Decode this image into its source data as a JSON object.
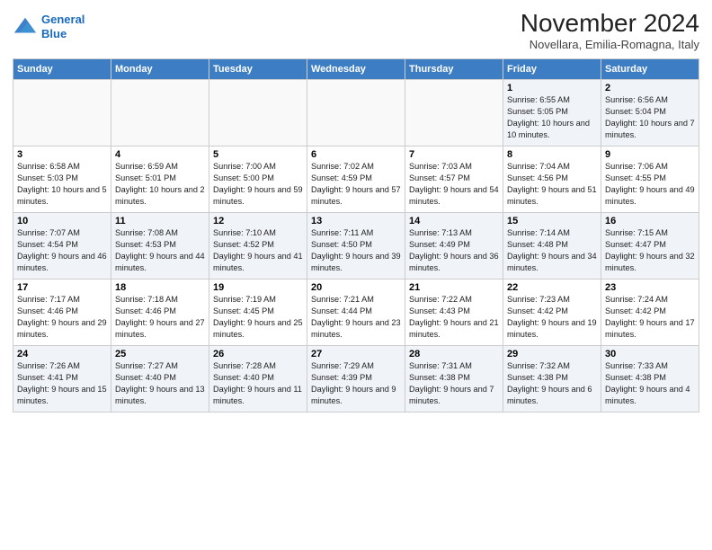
{
  "header": {
    "title": "November 2024",
    "location": "Novellara, Emilia-Romagna, Italy",
    "logo_line1": "General",
    "logo_line2": "Blue"
  },
  "days_of_week": [
    "Sunday",
    "Monday",
    "Tuesday",
    "Wednesday",
    "Thursday",
    "Friday",
    "Saturday"
  ],
  "weeks": [
    [
      {
        "day": "",
        "info": ""
      },
      {
        "day": "",
        "info": ""
      },
      {
        "day": "",
        "info": ""
      },
      {
        "day": "",
        "info": ""
      },
      {
        "day": "",
        "info": ""
      },
      {
        "day": "1",
        "info": "Sunrise: 6:55 AM\nSunset: 5:05 PM\nDaylight: 10 hours and 10 minutes."
      },
      {
        "day": "2",
        "info": "Sunrise: 6:56 AM\nSunset: 5:04 PM\nDaylight: 10 hours and 7 minutes."
      }
    ],
    [
      {
        "day": "3",
        "info": "Sunrise: 6:58 AM\nSunset: 5:03 PM\nDaylight: 10 hours and 5 minutes."
      },
      {
        "day": "4",
        "info": "Sunrise: 6:59 AM\nSunset: 5:01 PM\nDaylight: 10 hours and 2 minutes."
      },
      {
        "day": "5",
        "info": "Sunrise: 7:00 AM\nSunset: 5:00 PM\nDaylight: 9 hours and 59 minutes."
      },
      {
        "day": "6",
        "info": "Sunrise: 7:02 AM\nSunset: 4:59 PM\nDaylight: 9 hours and 57 minutes."
      },
      {
        "day": "7",
        "info": "Sunrise: 7:03 AM\nSunset: 4:57 PM\nDaylight: 9 hours and 54 minutes."
      },
      {
        "day": "8",
        "info": "Sunrise: 7:04 AM\nSunset: 4:56 PM\nDaylight: 9 hours and 51 minutes."
      },
      {
        "day": "9",
        "info": "Sunrise: 7:06 AM\nSunset: 4:55 PM\nDaylight: 9 hours and 49 minutes."
      }
    ],
    [
      {
        "day": "10",
        "info": "Sunrise: 7:07 AM\nSunset: 4:54 PM\nDaylight: 9 hours and 46 minutes."
      },
      {
        "day": "11",
        "info": "Sunrise: 7:08 AM\nSunset: 4:53 PM\nDaylight: 9 hours and 44 minutes."
      },
      {
        "day": "12",
        "info": "Sunrise: 7:10 AM\nSunset: 4:52 PM\nDaylight: 9 hours and 41 minutes."
      },
      {
        "day": "13",
        "info": "Sunrise: 7:11 AM\nSunset: 4:50 PM\nDaylight: 9 hours and 39 minutes."
      },
      {
        "day": "14",
        "info": "Sunrise: 7:13 AM\nSunset: 4:49 PM\nDaylight: 9 hours and 36 minutes."
      },
      {
        "day": "15",
        "info": "Sunrise: 7:14 AM\nSunset: 4:48 PM\nDaylight: 9 hours and 34 minutes."
      },
      {
        "day": "16",
        "info": "Sunrise: 7:15 AM\nSunset: 4:47 PM\nDaylight: 9 hours and 32 minutes."
      }
    ],
    [
      {
        "day": "17",
        "info": "Sunrise: 7:17 AM\nSunset: 4:46 PM\nDaylight: 9 hours and 29 minutes."
      },
      {
        "day": "18",
        "info": "Sunrise: 7:18 AM\nSunset: 4:46 PM\nDaylight: 9 hours and 27 minutes."
      },
      {
        "day": "19",
        "info": "Sunrise: 7:19 AM\nSunset: 4:45 PM\nDaylight: 9 hours and 25 minutes."
      },
      {
        "day": "20",
        "info": "Sunrise: 7:21 AM\nSunset: 4:44 PM\nDaylight: 9 hours and 23 minutes."
      },
      {
        "day": "21",
        "info": "Sunrise: 7:22 AM\nSunset: 4:43 PM\nDaylight: 9 hours and 21 minutes."
      },
      {
        "day": "22",
        "info": "Sunrise: 7:23 AM\nSunset: 4:42 PM\nDaylight: 9 hours and 19 minutes."
      },
      {
        "day": "23",
        "info": "Sunrise: 7:24 AM\nSunset: 4:42 PM\nDaylight: 9 hours and 17 minutes."
      }
    ],
    [
      {
        "day": "24",
        "info": "Sunrise: 7:26 AM\nSunset: 4:41 PM\nDaylight: 9 hours and 15 minutes."
      },
      {
        "day": "25",
        "info": "Sunrise: 7:27 AM\nSunset: 4:40 PM\nDaylight: 9 hours and 13 minutes."
      },
      {
        "day": "26",
        "info": "Sunrise: 7:28 AM\nSunset: 4:40 PM\nDaylight: 9 hours and 11 minutes."
      },
      {
        "day": "27",
        "info": "Sunrise: 7:29 AM\nSunset: 4:39 PM\nDaylight: 9 hours and 9 minutes."
      },
      {
        "day": "28",
        "info": "Sunrise: 7:31 AM\nSunset: 4:38 PM\nDaylight: 9 hours and 7 minutes."
      },
      {
        "day": "29",
        "info": "Sunrise: 7:32 AM\nSunset: 4:38 PM\nDaylight: 9 hours and 6 minutes."
      },
      {
        "day": "30",
        "info": "Sunrise: 7:33 AM\nSunset: 4:38 PM\nDaylight: 9 hours and 4 minutes."
      }
    ]
  ]
}
